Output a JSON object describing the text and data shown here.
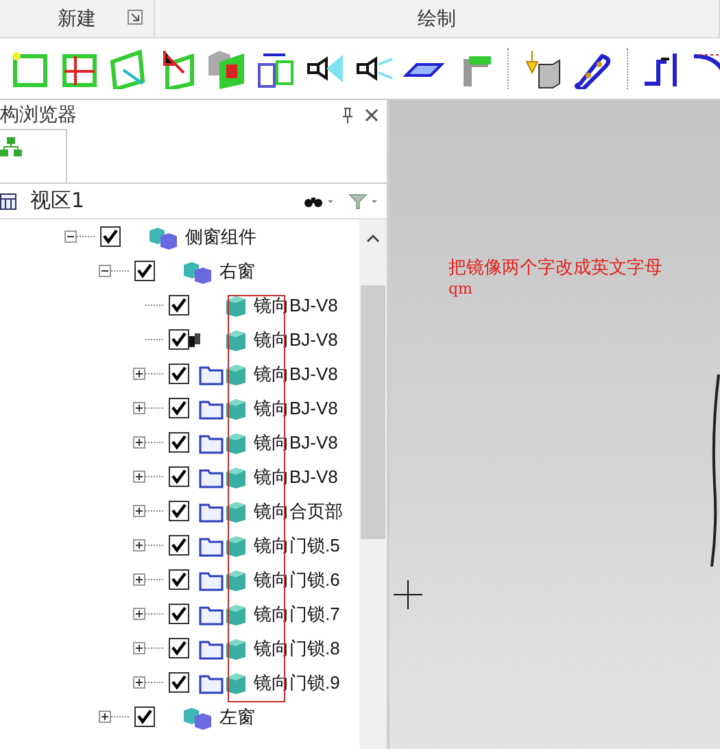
{
  "ribbon": {
    "groups": [
      {
        "label": "新建",
        "launcher": true
      },
      {
        "label": "绘制",
        "launcher": false
      }
    ]
  },
  "panel": {
    "title": "构浏览器",
    "view": {
      "label": "视区1"
    },
    "tree": [
      {
        "label": "侧窗组件",
        "checked": true,
        "expanded": true,
        "kind": "assembly",
        "children": [
          {
            "label": "右窗",
            "checked": true,
            "expanded": true,
            "kind": "assembly",
            "children": [
              {
                "label": "镜向BJ-V8",
                "checked": true,
                "kind": "part"
              },
              {
                "label": "镜向BJ-V8",
                "checked": true,
                "kind": "linked_part"
              },
              {
                "label": "镜向BJ-V8",
                "checked": true,
                "expanded": false,
                "kind": "folder_part"
              },
              {
                "label": "镜向BJ-V8",
                "checked": true,
                "expanded": false,
                "kind": "folder_part"
              },
              {
                "label": "镜向BJ-V8",
                "checked": true,
                "expanded": false,
                "kind": "folder_part"
              },
              {
                "label": "镜向BJ-V8",
                "checked": true,
                "expanded": false,
                "kind": "folder_part"
              },
              {
                "label": "镜向合页部",
                "checked": true,
                "expanded": false,
                "kind": "folder_part"
              },
              {
                "label": "镜向门锁.5",
                "checked": true,
                "expanded": false,
                "kind": "folder_part"
              },
              {
                "label": "镜向门锁.6",
                "checked": true,
                "expanded": false,
                "kind": "folder_part"
              },
              {
                "label": "镜向门锁.7",
                "checked": true,
                "expanded": false,
                "kind": "folder_part"
              },
              {
                "label": "镜向门锁.8",
                "checked": true,
                "expanded": false,
                "kind": "folder_part"
              },
              {
                "label": "镜向门锁.9",
                "checked": true,
                "expanded": false,
                "kind": "folder_part"
              }
            ]
          },
          {
            "label": "左窗",
            "checked": true,
            "expanded": false,
            "kind": "assembly"
          }
        ]
      }
    ]
  },
  "annotation": {
    "text": "把镜像两个字改成英文字母",
    "subtext": "qm"
  }
}
